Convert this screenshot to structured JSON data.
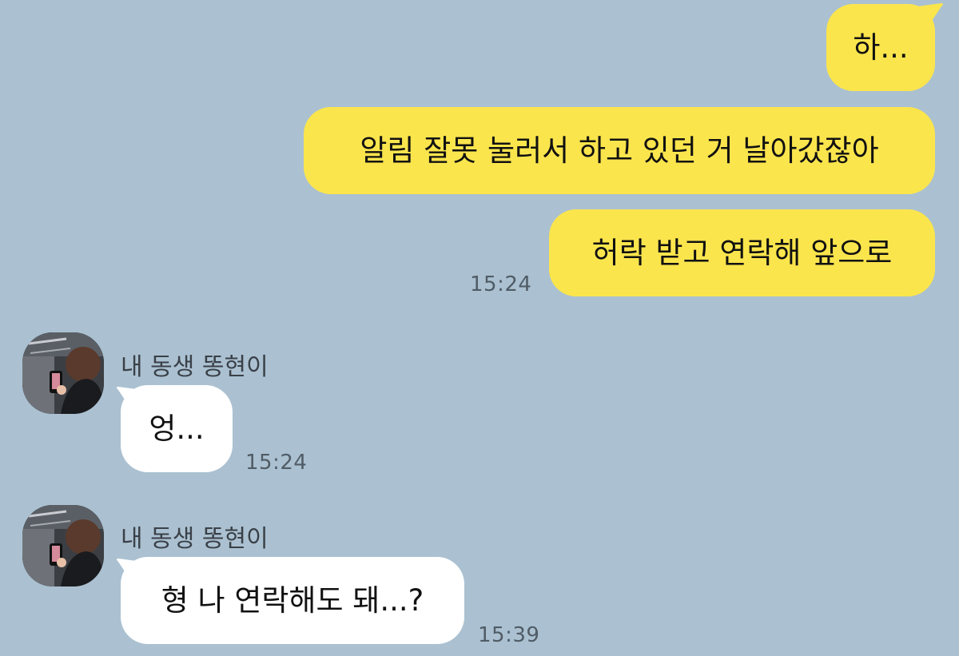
{
  "colors": {
    "background": "#abc1d1",
    "my_bubble": "#fbe54d",
    "their_bubble": "#ffffff",
    "timestamp": "#505c66",
    "sender_name": "#3a4048"
  },
  "messages": [
    {
      "from": "me",
      "text": "하..."
    },
    {
      "from": "me",
      "text": "알림 잘못 눌러서 하고 있던 거 날아갔잖아"
    },
    {
      "from": "me",
      "text": "허락 받고 연락해 앞으로",
      "time": "15:24"
    },
    {
      "from": "them",
      "sender": "내 동생 똥현이",
      "avatar": "contact-profile-photo",
      "text": "엉...",
      "time": "15:24"
    },
    {
      "from": "them",
      "sender": "내 동생 똥현이",
      "avatar": "contact-profile-photo",
      "text": "형 나 연락해도 돼...?",
      "time": "15:39"
    }
  ]
}
